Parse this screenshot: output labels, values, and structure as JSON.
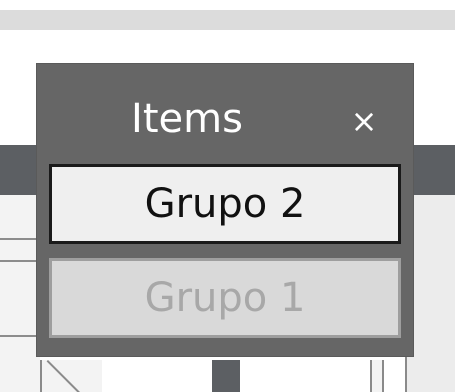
{
  "popup": {
    "title": "Items",
    "close_label": "×",
    "items": [
      {
        "label": "Grupo 2",
        "state": "selected"
      },
      {
        "label": "Grupo 1",
        "state": "disabled"
      }
    ]
  },
  "colors": {
    "popup_bg": "#666666",
    "selected_bg": "#efefef",
    "disabled_bg": "#d9d9d9",
    "disabled_text": "#a8a8a8"
  }
}
